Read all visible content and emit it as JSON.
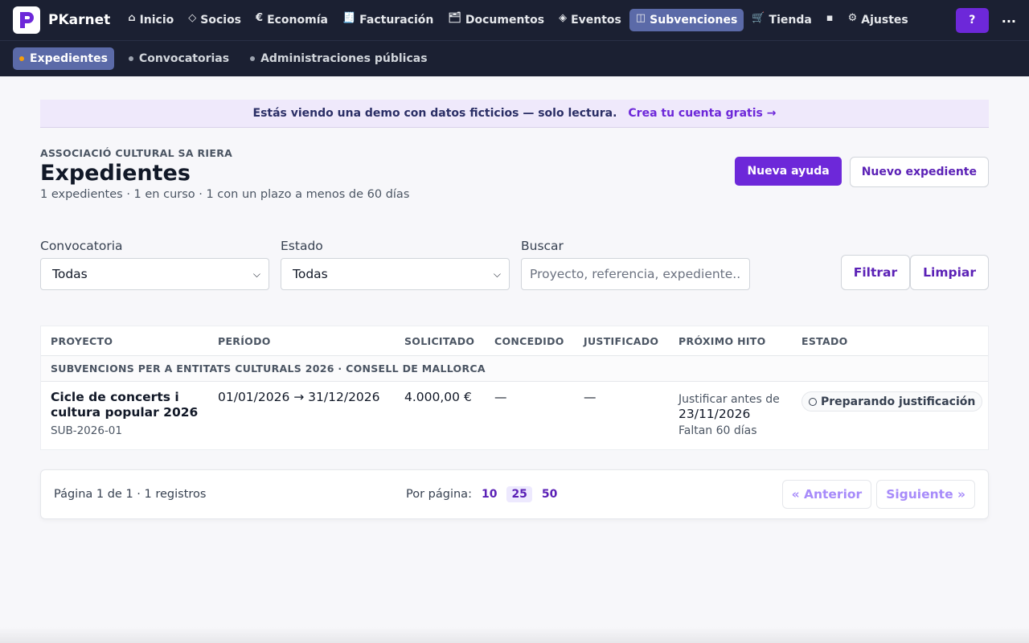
{
  "app": {
    "name": "PKarnet",
    "logo_letter": "P"
  },
  "nav": {
    "items": [
      {
        "label": "Inicio",
        "icon": "home-icon",
        "glyph": "⌂"
      },
      {
        "label": "Socios",
        "icon": "diamond-icon",
        "glyph": "◇"
      },
      {
        "label": "Economía",
        "icon": "euro-icon",
        "glyph": "€"
      },
      {
        "label": "Facturación",
        "icon": "invoice-icon",
        "glyph": "🧾"
      },
      {
        "label": "Documentos",
        "icon": "folder-icon",
        "glyph": "🗂"
      },
      {
        "label": "Eventos",
        "icon": "event-icon",
        "glyph": "◈"
      },
      {
        "label": "Subvenciones",
        "icon": "columns-icon",
        "glyph": "◫",
        "active": true
      },
      {
        "label": "Tienda",
        "icon": "cart-icon",
        "glyph": "🛒"
      },
      {
        "label": "",
        "icon": "block-icon",
        "glyph": "▪"
      },
      {
        "label": "Ajustes",
        "icon": "gear-icon",
        "glyph": "⚙"
      }
    ],
    "help_label": "?",
    "more_label": "..."
  },
  "subnav": {
    "items": [
      {
        "label": "Expedientes",
        "active": true
      },
      {
        "label": "Convocatorias"
      },
      {
        "label": "Administraciones públicas"
      }
    ]
  },
  "banner": {
    "text": "Estás viendo una demo con datos ficticios — solo lectura.",
    "link": "Crea tu cuenta gratis →"
  },
  "header": {
    "org": "ASSOCIACIÓ CULTURAL SA RIERA",
    "title": "Expedientes",
    "summary": "1 expedientes · 1 en curso · 1 con un plazo a menos de 60 días",
    "new_aid": "Nueva ayuda",
    "new_file": "Nuevo expediente"
  },
  "filters": {
    "convocatoria_label": "Convocatoria",
    "convocatoria_value": "Todas",
    "estado_label": "Estado",
    "estado_value": "Todas",
    "buscar_label": "Buscar",
    "buscar_placeholder": "Proyecto, referencia, expediente...",
    "filter_btn": "Filtrar",
    "clear_btn": "Limpiar"
  },
  "table": {
    "headers": [
      "PROYECTO",
      "PERÍODO",
      "SOLICITADO",
      "CONCEDIDO",
      "JUSTIFICADO",
      "PRÓXIMO HITO",
      "ESTADO"
    ],
    "group": "SUBVENCIONS PER A ENTITATS CULTURALS 2026 · CONSELL DE MALLORCA",
    "rows": [
      {
        "project": "Cicle de concerts i cultura popular 2026",
        "reference": "SUB-2026-01",
        "period": "01/01/2026 → 31/12/2026",
        "requested": "4.000,00 €",
        "granted": "—",
        "justified": "—",
        "milestone_pre": "Justificar antes de",
        "milestone_date": "23/11/2026",
        "milestone_left": "Faltan 60 días",
        "status": "Preparando justificación"
      }
    ]
  },
  "pager": {
    "info": "Página 1 de 1 · 1 registros",
    "per_page_label": "Por página:",
    "sizes": [
      "10",
      "25",
      "50"
    ],
    "active_size": "25",
    "prev": "« Anterior",
    "next": "Siguiente »"
  },
  "colors": {
    "accent": "#6d28d9",
    "nav_bg": "#1b2032",
    "active_nav": "#5b6aa8"
  }
}
